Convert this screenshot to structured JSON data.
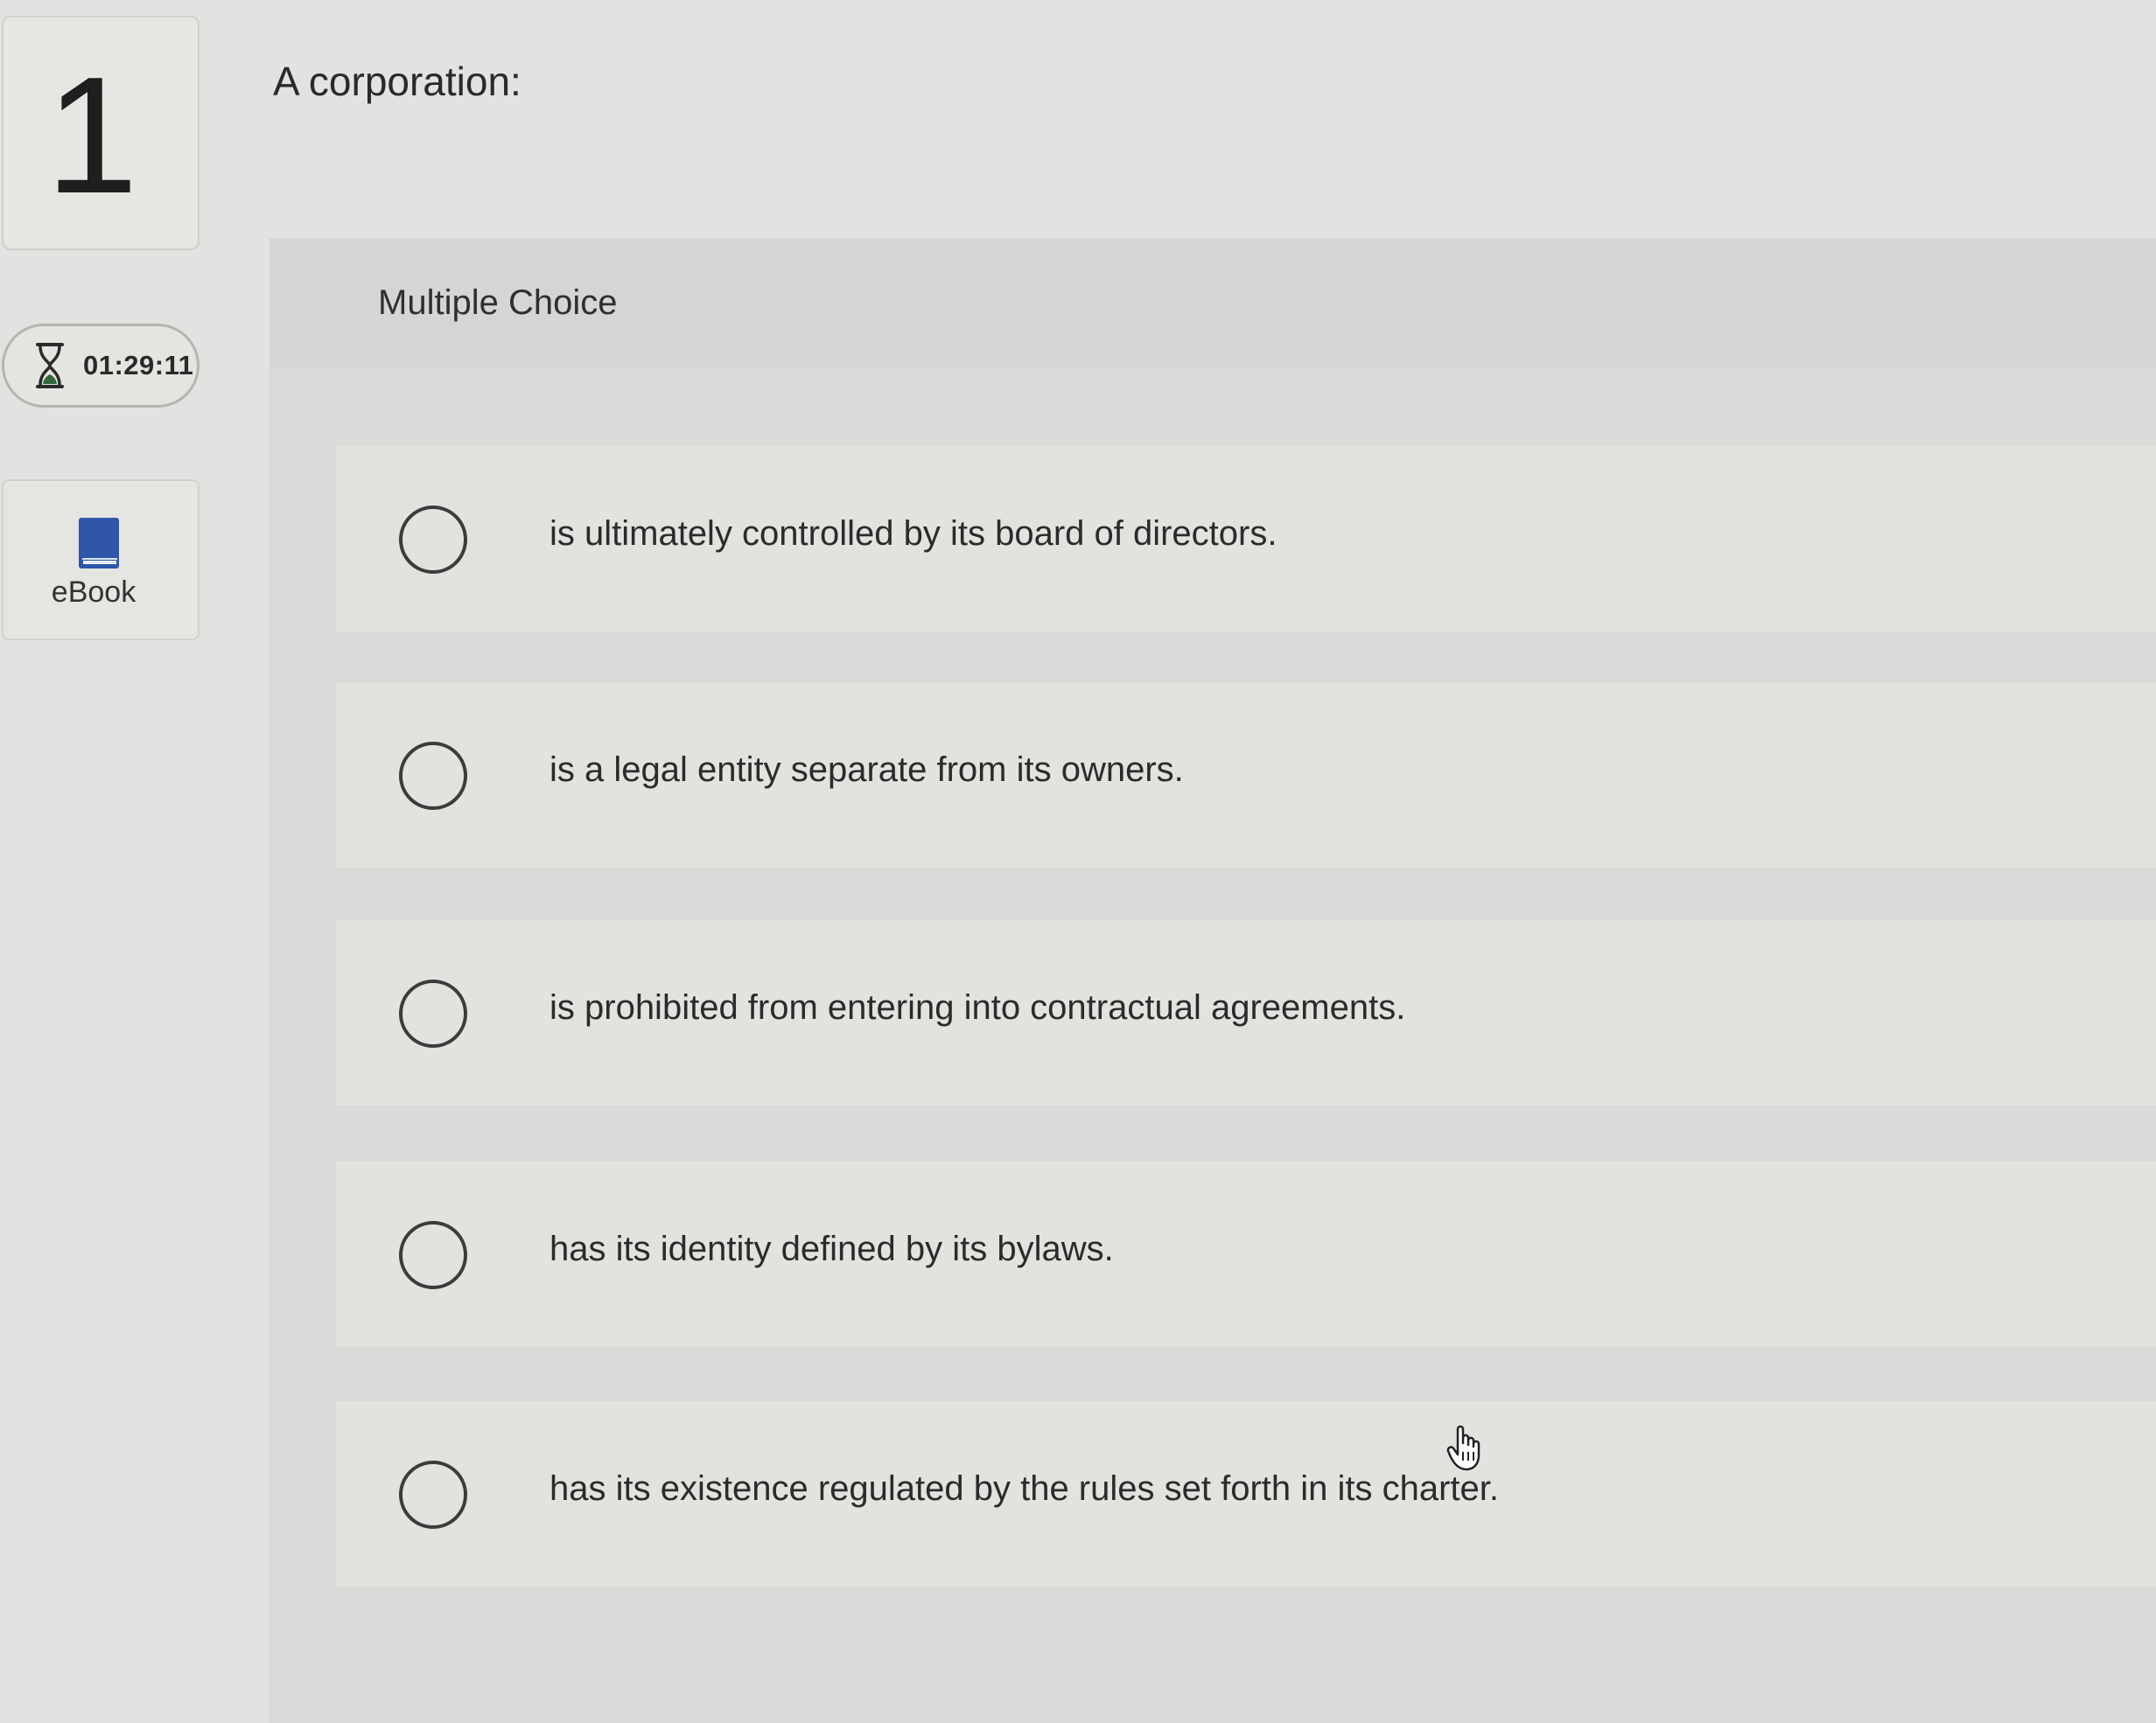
{
  "question": {
    "number": "1",
    "prompt": "A corporation:"
  },
  "timer": {
    "icon": "hourglass-icon",
    "value": "01:29:11"
  },
  "ebook": {
    "icon": "book-icon",
    "label": "eBook"
  },
  "choices_panel": {
    "title": "Multiple Choice",
    "options": [
      {
        "label": "is ultimately controlled by its board of directors.",
        "selected": false
      },
      {
        "label": "is a legal entity separate from its owners.",
        "selected": false
      },
      {
        "label": "is prohibited from entering into contractual agreements.",
        "selected": false
      },
      {
        "label": "has its identity defined by its bylaws.",
        "selected": false
      },
      {
        "label": "has its existence regulated by the rules set forth in its charter.",
        "selected": false
      }
    ]
  },
  "colors": {
    "ebook_icon": "#2f56a8",
    "hourglass_sand": "#2f6b3a"
  }
}
